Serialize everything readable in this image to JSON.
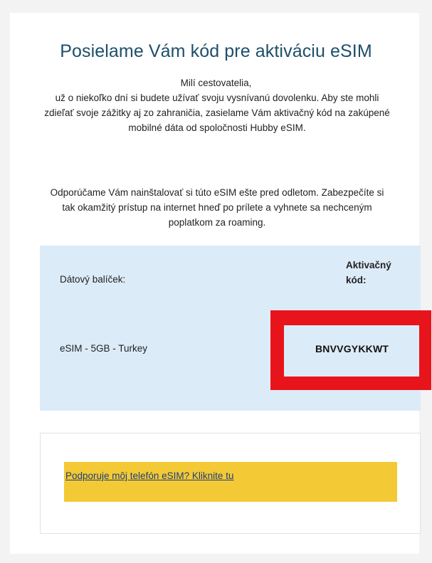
{
  "email": {
    "title": "Posielame Vám kód pre aktiváciu eSIM",
    "greeting": "Milí cestovatelia,",
    "intro": "už o niekoľko dní si budete užívať svoju vysnívanú dovolenku. Aby ste mohli zdieľať svoje zážitky aj zo zahraničia, zasielame Vám aktivačný kód na zakúpené mobilné dáta od spoločnosti Hubby eSIM.",
    "advice": "Odporúčame Vám nainštalovať si túto eSIM ešte pred odletom. Zabezpečíte si tak okamžitý prístup na internet hneď po prílete a vyhnete sa nechceným poplatkom za roaming."
  },
  "activation": {
    "package_label": "Dátový balíček:",
    "code_label": "Aktivačný kód:",
    "package_value": "eSIM - 5GB - Turkey",
    "code_value": "BNVVGYKKWT"
  },
  "cta": {
    "link_label": "Podporuje môj telefón eSIM? Kliknite tu"
  },
  "colors": {
    "title": "#1d4f6a",
    "info_box": "#dcebf8",
    "highlight": "#e8141b",
    "cta_bar": "#f3c935",
    "link": "#1f3f7a"
  }
}
